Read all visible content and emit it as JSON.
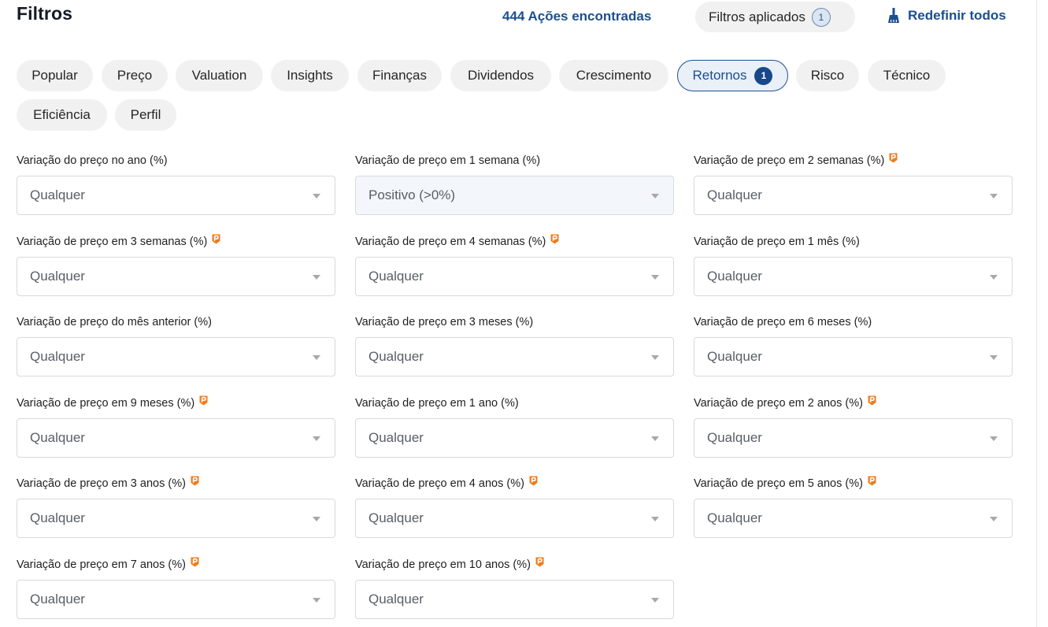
{
  "header": {
    "title": "Filtros",
    "results_count": "444 Ações encontradas",
    "applied_filters_label": "Filtros aplicados",
    "applied_filters_count": "1",
    "reset_label": "Redefinir todos"
  },
  "tabs": [
    {
      "label": "Popular"
    },
    {
      "label": "Preço"
    },
    {
      "label": "Valuation"
    },
    {
      "label": "Insights"
    },
    {
      "label": "Finanças"
    },
    {
      "label": "Dividendos"
    },
    {
      "label": "Crescimento"
    },
    {
      "label": "Retornos",
      "active": true,
      "badge": "1"
    },
    {
      "label": "Risco"
    },
    {
      "label": "Técnico"
    },
    {
      "label": "Eficiência"
    },
    {
      "label": "Perfil"
    }
  ],
  "colors": {
    "accent": "#1b4f8f",
    "pro_badge": "#f07c1b",
    "chip_bg": "#f1f1f1"
  },
  "fields": [
    {
      "label": "Variação do preço no ano (%)",
      "value": "Qualquer",
      "pro": false
    },
    {
      "label": "Variação de preço em 1 semana (%)",
      "value": "Positivo (>0%)",
      "pro": false,
      "selected": true
    },
    {
      "label": "Variação de preço em 2 semanas (%)",
      "value": "Qualquer",
      "pro": true
    },
    {
      "label": "Variação de preço em 3 semanas (%)",
      "value": "Qualquer",
      "pro": true
    },
    {
      "label": "Variação de preço em 4 semanas (%)",
      "value": "Qualquer",
      "pro": true
    },
    {
      "label": "Variação de preço em 1 mês (%)",
      "value": "Qualquer",
      "pro": false
    },
    {
      "label": "Variação de preço do mês anterior (%)",
      "value": "Qualquer",
      "pro": false
    },
    {
      "label": "Variação de preço em 3 meses (%)",
      "value": "Qualquer",
      "pro": false
    },
    {
      "label": "Variação de preço em 6 meses (%)",
      "value": "Qualquer",
      "pro": false
    },
    {
      "label": "Variação de preço em 9 meses (%)",
      "value": "Qualquer",
      "pro": true
    },
    {
      "label": "Variação de preço em 1 ano (%)",
      "value": "Qualquer",
      "pro": false
    },
    {
      "label": "Variação de preço em 2 anos (%)",
      "value": "Qualquer",
      "pro": true
    },
    {
      "label": "Variação de preço em 3 anos (%)",
      "value": "Qualquer",
      "pro": true
    },
    {
      "label": "Variação de preço em 4 anos (%)",
      "value": "Qualquer",
      "pro": true
    },
    {
      "label": "Variação de preço em 5 anos (%)",
      "value": "Qualquer",
      "pro": true
    },
    {
      "label": "Variação de preço em 7 anos (%)",
      "value": "Qualquer",
      "pro": true
    },
    {
      "label": "Variação de preço em 10 anos (%)",
      "value": "Qualquer",
      "pro": true
    }
  ]
}
